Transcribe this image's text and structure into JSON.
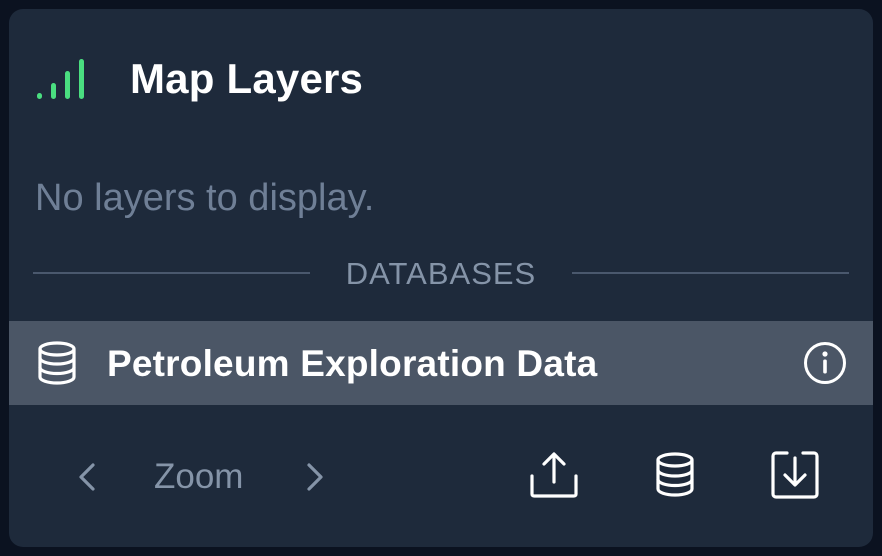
{
  "panel": {
    "title": "Map Layers",
    "title_icon": "signal-bars-icon",
    "empty_message": "No layers to display.",
    "section_label": "DATABASES"
  },
  "databases": [
    {
      "name": "Petroleum Exploration Data",
      "icon": "database-icon",
      "info_icon": "info-icon"
    }
  ],
  "footer": {
    "zoom_label": "Zoom",
    "prev_icon": "chevron-left-icon",
    "next_icon": "chevron-right-icon",
    "tools": [
      "export-icon",
      "database-icon",
      "download-icon"
    ]
  },
  "colors": {
    "background": "#0b1220",
    "panel": "#1e2a3b",
    "selected_row": "#4b5666",
    "accent_green": "#4ade80",
    "muted_text": "#6f7f96",
    "label_text": "#8594a8",
    "icon": "#ffffff"
  }
}
